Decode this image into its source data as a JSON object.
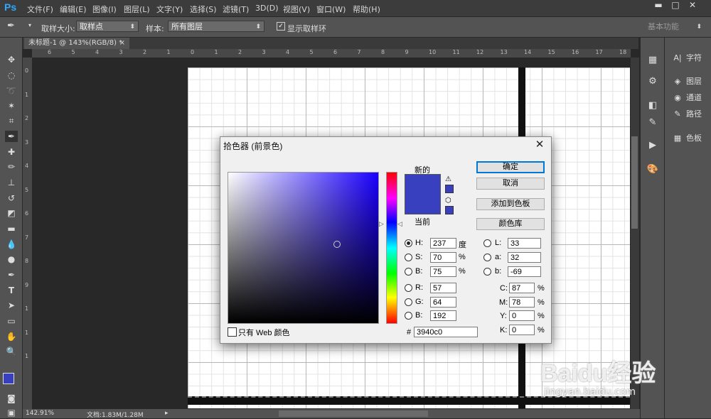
{
  "app": {
    "logo": "Ps"
  },
  "menu": [
    "文件(F)",
    "编辑(E)",
    "图像(I)",
    "图层(L)",
    "文字(Y)",
    "选择(S)",
    "滤镜(T)",
    "3D(D)",
    "视图(V)",
    "窗口(W)",
    "帮助(H)"
  ],
  "window_controls": {
    "minimize": "▬",
    "restore": "□",
    "close": "✕"
  },
  "options_bar": {
    "sample_size_label": "取样大小:",
    "sample_size_value": "取样点",
    "sample_label": "样本:",
    "sample_value": "所有图层",
    "show_ring_label": "显示取样环",
    "show_ring_checked": true,
    "workspace": "基本功能"
  },
  "document_tab": {
    "title": "未标题-1 @ 143%(RGB/8) *",
    "close": "×"
  },
  "ruler": {
    "h_labels": [
      "6",
      "5",
      "4",
      "3",
      "2",
      "1",
      "0",
      "1",
      "2",
      "3",
      "4",
      "5",
      "6",
      "7",
      "8",
      "9",
      "10",
      "11",
      "12",
      "13",
      "14",
      "15",
      "16",
      "17",
      "18"
    ],
    "v_labels": [
      "0",
      "1",
      "2",
      "3",
      "4",
      "5",
      "6",
      "7",
      "8",
      "9",
      "1",
      "1",
      "1"
    ]
  },
  "right_panels": [
    {
      "icon": "character-icon",
      "glyph": "A|",
      "label": "字符"
    },
    {
      "icon": "layers-icon",
      "glyph": "◈",
      "label": "图层"
    },
    {
      "icon": "channels-icon",
      "glyph": "◉",
      "label": "通道"
    },
    {
      "icon": "paths-icon",
      "glyph": "✎",
      "label": "路径"
    },
    {
      "icon": "swatches-icon",
      "glyph": "▦",
      "label": "色板"
    }
  ],
  "status": {
    "zoom": "142.91%",
    "doc": "文档:1.83M/1.28M"
  },
  "dialog": {
    "title": "拾色器 (前景色)",
    "close": "✕",
    "label_new": "新的",
    "label_current": "当前",
    "new_color": "#3940c0",
    "current_color": "#3940c0",
    "buttons": {
      "ok": "确定",
      "cancel": "取消",
      "add_to_swatches": "添加到色板",
      "color_libraries": "颜色库"
    },
    "hsb": {
      "h_label": "H:",
      "h": "237",
      "h_unit": "度",
      "s_label": "S:",
      "s": "70",
      "s_unit": "%",
      "b_label": "B:",
      "b": "75",
      "b_unit": "%"
    },
    "rgb": {
      "r_label": "R:",
      "r": "57",
      "g_label": "G:",
      "g": "64",
      "b_label": "B:",
      "b": "192"
    },
    "lab": {
      "l_label": "L:",
      "l": "33",
      "a_label": "a:",
      "a": "32",
      "b_label": "b:",
      "b": "-69"
    },
    "cmyk": {
      "c_label": "C:",
      "c": "87",
      "m_label": "M:",
      "m": "78",
      "y_label": "Y:",
      "y": "0",
      "k_label": "K:",
      "k": "0",
      "unit": "%"
    },
    "hex_label": "#",
    "hex": "3940c0",
    "web_only_label": "只有 Web 颜色",
    "web_only_checked": false,
    "selected_mode": "H"
  },
  "watermark": {
    "brand": "Baidu经验",
    "url": "jingyan.baidu.com"
  }
}
